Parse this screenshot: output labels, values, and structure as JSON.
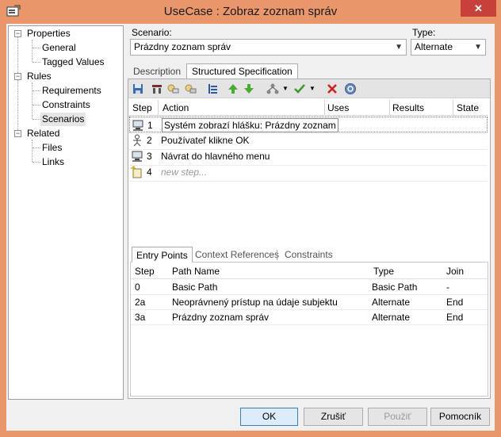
{
  "window": {
    "title": "UseCase : Zobraz zoznam správ",
    "close_label": "✕"
  },
  "tree": {
    "items": [
      {
        "label": "Properties",
        "level": 0,
        "expander": "−"
      },
      {
        "label": "General",
        "level": 1
      },
      {
        "label": "Tagged Values",
        "level": 1
      },
      {
        "label": "Rules",
        "level": 0,
        "expander": "−"
      },
      {
        "label": "Requirements",
        "level": 1
      },
      {
        "label": "Constraints",
        "level": 1
      },
      {
        "label": "Scenarios",
        "level": 1,
        "selected": true
      },
      {
        "label": "Related",
        "level": 0,
        "expander": "−"
      },
      {
        "label": "Files",
        "level": 1
      },
      {
        "label": "Links",
        "level": 1
      }
    ]
  },
  "scenario": {
    "label": "Scenario:",
    "value": "Prázdny zoznam správ"
  },
  "type": {
    "label": "Type:",
    "value": "Alternate"
  },
  "tabs": [
    {
      "label": "Description",
      "active": false
    },
    {
      "label": "Structured Specification",
      "active": true
    }
  ],
  "toolbar_icons": [
    "save-icon",
    "table-icon",
    "copy-icon",
    "paste-icon",
    "list-icon",
    "move-up-icon",
    "move-down-icon",
    "hierarchy-icon",
    "check-icon",
    "delete-icon",
    "help-icon"
  ],
  "steps_grid": {
    "columns": [
      "Step",
      "Action",
      "Uses",
      "Results",
      "State"
    ],
    "rows": [
      {
        "num": "1",
        "action": "Systém zobrazí hlášku: Prázdny zoznam",
        "icon": "system-icon"
      },
      {
        "num": "2",
        "action": "Používateľ klikne OK",
        "icon": "actor-icon"
      },
      {
        "num": "3",
        "action": "Návrat do hlavného menu",
        "icon": "system-icon"
      },
      {
        "num": "4",
        "action": "new step...",
        "icon": "new-step-icon",
        "placeholder": true
      }
    ]
  },
  "lower_tabs": [
    {
      "label": "Entry Points",
      "active": true
    },
    {
      "label": "Context References",
      "active": false
    },
    {
      "label": "Constraints",
      "active": false
    }
  ],
  "entry_points": {
    "columns": [
      "Step",
      "Path Name",
      "Type",
      "Join"
    ],
    "rows": [
      {
        "step": "0",
        "path": "Basic Path",
        "type": "Basic Path",
        "join": "-"
      },
      {
        "step": "2a",
        "path": "Neoprávnený prístup na údaje subjektu",
        "type": "Alternate",
        "join": "End"
      },
      {
        "step": "3a",
        "path": "Prázdny zoznam správ",
        "type": "Alternate",
        "join": "End"
      }
    ]
  },
  "buttons": {
    "ok": "OK",
    "cancel": "Zrušiť",
    "apply": "Použiť",
    "help": "Pomocník"
  }
}
